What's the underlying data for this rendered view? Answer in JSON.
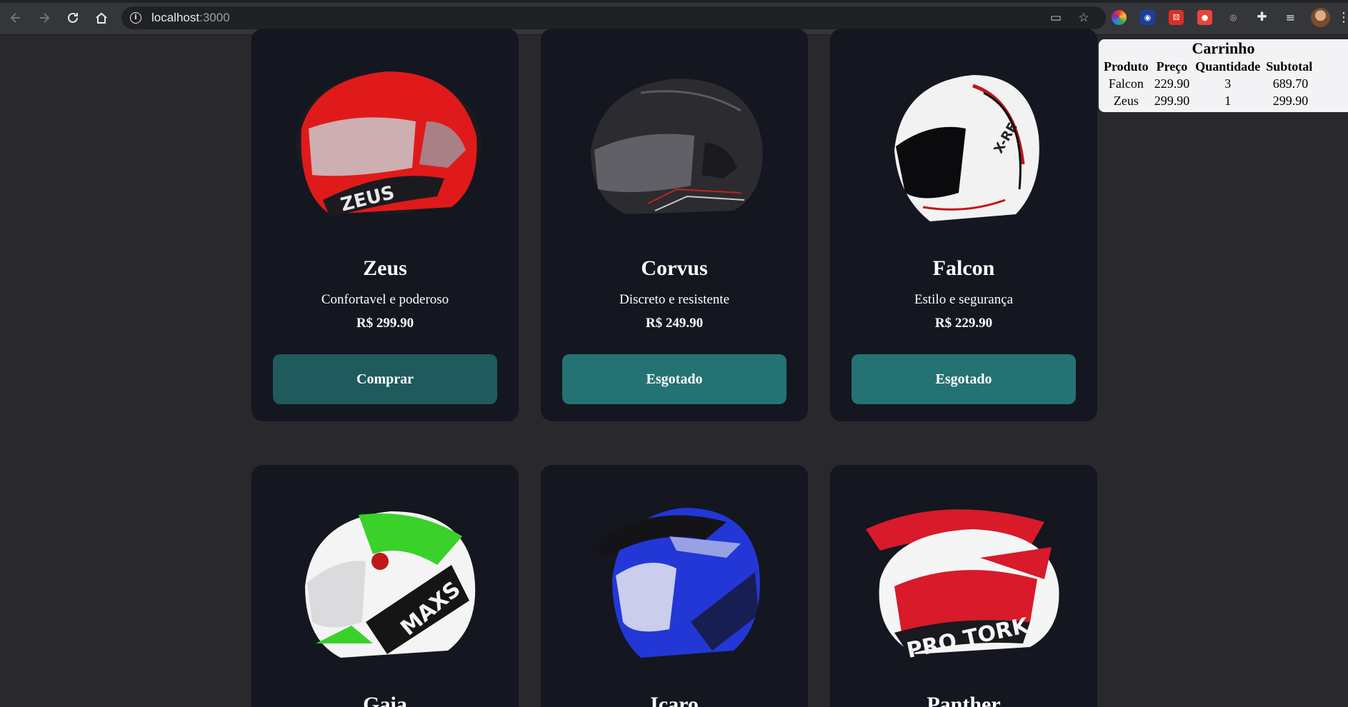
{
  "browser": {
    "url_host": "localhost",
    "url_port": ":3000",
    "icons": {
      "back": "arrow-left-icon",
      "forward": "arrow-right-icon",
      "reload": "reload-icon",
      "home": "home-icon",
      "site_info": "info-icon",
      "cast": "cast-icon",
      "bookmark": "star-icon",
      "extensions": "puzzle-icon",
      "reading_list": "reading-list-icon",
      "menu": "kebab-menu-icon"
    }
  },
  "products": [
    {
      "name": "Zeus",
      "description": "Confortavel e poderoso",
      "price": "R$ 299.90",
      "button": "Comprar",
      "status": "available",
      "colors": [
        "#e01a1a",
        "#1b1b1f",
        "#c9c9cc"
      ]
    },
    {
      "name": "Corvus",
      "description": "Discreto e resistente",
      "price": "R$ 249.90",
      "button": "Esgotado",
      "status": "sold-out",
      "colors": [
        "#2b2b30",
        "#111114",
        "#c62020"
      ]
    },
    {
      "name": "Falcon",
      "description": "Estilo e segurança",
      "price": "R$ 229.90",
      "button": "Esgotado",
      "status": "sold-out",
      "colors": [
        "#f2f2f2",
        "#0b0b0d",
        "#c01818"
      ]
    },
    {
      "name": "Gaia",
      "colors": [
        "#3ad12a",
        "#f4f4f4",
        "#151515"
      ]
    },
    {
      "name": "Icaro",
      "colors": [
        "#2337d6",
        "#141418",
        "#e8e8ee"
      ]
    },
    {
      "name": "Panther",
      "colors": [
        "#d81a2a",
        "#f5f5f5",
        "#1a1a1e"
      ]
    }
  ],
  "cart": {
    "title": "Carrinho",
    "headers": [
      "Produto",
      "Preço",
      "Quantidade",
      "Subtotal"
    ],
    "rows": [
      {
        "product": "Falcon",
        "price": "229.90",
        "quantity": "3",
        "subtotal": "689.70"
      },
      {
        "product": "Zeus",
        "price": "299.90",
        "quantity": "1",
        "subtotal": "299.90"
      }
    ]
  },
  "theme": {
    "page_bg": "#29282d",
    "card_bg": "#141620",
    "button_teal": "#257274",
    "cart_bg": "#f3f3f6"
  }
}
